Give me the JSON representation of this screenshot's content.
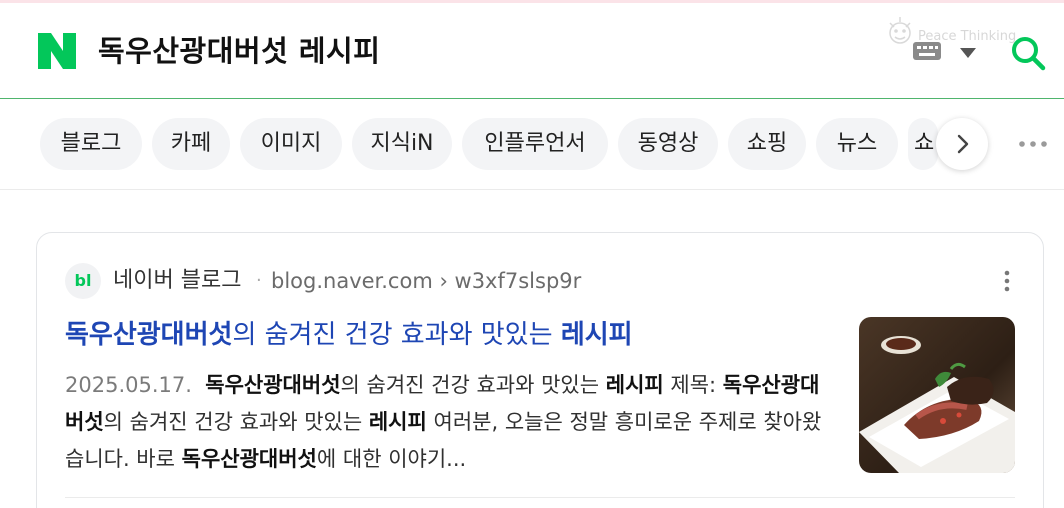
{
  "search": {
    "query": "독우산광대버섯 레시피",
    "watermark": "Peace Thinking"
  },
  "tabs": [
    {
      "label": "블로그"
    },
    {
      "label": "카페"
    },
    {
      "label": "이미지"
    },
    {
      "label": "지식iN"
    },
    {
      "label": "인플루언서"
    },
    {
      "label": "동영상"
    },
    {
      "label": "쇼핑"
    },
    {
      "label": "뉴스"
    },
    {
      "label": "쇼"
    }
  ],
  "result": {
    "source_icon_text": "bl",
    "source_name": "네이버 블로그",
    "source_sep": "·",
    "source_url": "blog.naver.com › w3xf7slsp9r",
    "title": {
      "highlight1": "독우산광대버섯",
      "middle": "의 숨겨진 건강 효과와 맛있는 ",
      "highlight2": "레시피"
    },
    "description": {
      "date": "2025.05.17.",
      "p1_b": "독우산광대버섯",
      "p2": "의 숨겨진 건강 효과와 맛있는 ",
      "p3_b": "레시피",
      "p4": " 제목: ",
      "p5_b": "독우산광대버섯",
      "p6": "의 숨겨진 건강 효과와 맛있는 ",
      "p7_b": "레시피",
      "p8": " 여러분, 오늘은 정말 흥미로운 주제로 찾아왔습니다. 바로 ",
      "p9_b": "독우산광대버섯",
      "p10": "에 대한 이야기..."
    }
  },
  "colors": {
    "naver_green": "#03c75a",
    "title_blue": "#1e46b4"
  }
}
